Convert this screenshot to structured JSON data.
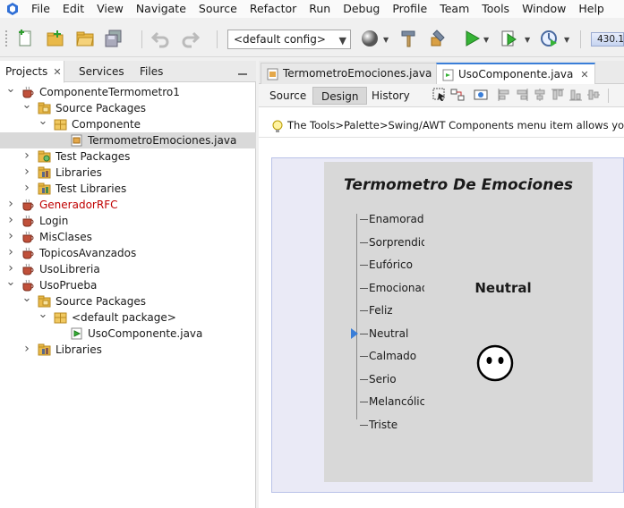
{
  "menu": [
    "File",
    "Edit",
    "View",
    "Navigate",
    "Source",
    "Refactor",
    "Run",
    "Debug",
    "Profile",
    "Team",
    "Tools",
    "Window",
    "Help"
  ],
  "toolbar": {
    "config_value": "<default config>",
    "memory_text": "430.1"
  },
  "left_tabs": [
    {
      "label": "Projects"
    },
    {
      "label": "Services"
    },
    {
      "label": "Files"
    }
  ],
  "tree": [
    {
      "label": "ComponenteTermometro1",
      "icon": "project-cup-icon",
      "depth": 0,
      "expanded": true
    },
    {
      "label": "Source Packages",
      "icon": "source-packages-icon",
      "depth": 1,
      "expanded": true
    },
    {
      "label": "Componente",
      "icon": "package-icon",
      "depth": 2,
      "expanded": true
    },
    {
      "label": "TermometroEmociones.java",
      "icon": "java-form-icon",
      "depth": 3,
      "selected": true
    },
    {
      "label": "Test Packages",
      "icon": "test-packages-icon",
      "depth": 1,
      "expanded": false
    },
    {
      "label": "Libraries",
      "icon": "libraries-icon",
      "depth": 1,
      "expanded": false
    },
    {
      "label": "Test Libraries",
      "icon": "test-libraries-icon",
      "depth": 1,
      "expanded": false
    },
    {
      "label": "GeneradorRFC",
      "icon": "project-cup-icon",
      "depth": 0,
      "expanded": false,
      "error": true
    },
    {
      "label": "Login",
      "icon": "project-cup-icon",
      "depth": 0,
      "expanded": false
    },
    {
      "label": "MisClases",
      "icon": "project-cup-icon",
      "depth": 0,
      "expanded": false
    },
    {
      "label": "TopicosAvanzados",
      "icon": "project-cup-icon",
      "depth": 0,
      "expanded": false
    },
    {
      "label": "UsoLibreria",
      "icon": "project-cup-icon",
      "depth": 0,
      "expanded": false
    },
    {
      "label": "UsoPrueba",
      "icon": "project-cup-icon",
      "depth": 0,
      "expanded": true
    },
    {
      "label": "Source Packages",
      "icon": "source-packages-icon",
      "depth": 1,
      "expanded": true
    },
    {
      "label": "<default package>",
      "icon": "package-icon",
      "depth": 2,
      "expanded": true
    },
    {
      "label": "UsoComponente.java",
      "icon": "java-file-icon",
      "depth": 3
    },
    {
      "label": "Libraries",
      "icon": "libraries-icon",
      "depth": 1,
      "expanded": false
    }
  ],
  "doc_tabs": [
    {
      "label": "TermometroEmociones.java",
      "active": false
    },
    {
      "label": "UsoComponente.java",
      "active": true
    }
  ],
  "view_buttons": [
    {
      "label": "Source",
      "active": false
    },
    {
      "label": "Design",
      "active": true
    },
    {
      "label": "History",
      "active": false
    }
  ],
  "hint": "The Tools>Palette>Swing/AWT Components menu item allows you to m",
  "component": {
    "title": "Termometro De Emociones",
    "emotions": [
      "Enamorado",
      "Sorprendido",
      "Eufórico",
      "Emocionado",
      "Feliz",
      "Neutral",
      "Calmado",
      "Serio",
      "Melancólico",
      "Triste"
    ],
    "selected_index": 5,
    "mood_label": "Neutral",
    "face": "neutral-face-icon"
  },
  "colors": {
    "accent": "#3a7ed8",
    "error_text": "#c00000",
    "component_bg": "#d8d8d8",
    "design_bg": "#eaeaf6"
  }
}
